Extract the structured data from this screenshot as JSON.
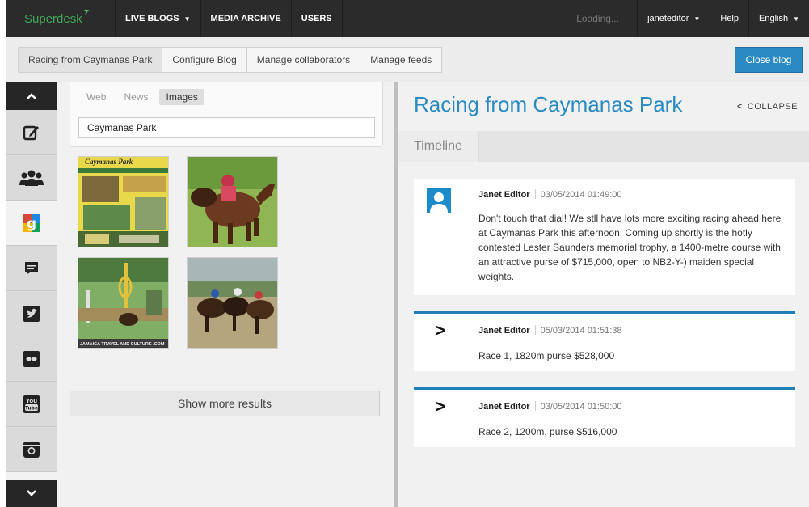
{
  "topbar": {
    "brand": "Superdesk",
    "nav": [
      {
        "label": "LIVE BLOGS",
        "caret": true
      },
      {
        "label": "MEDIA ARCHIVE",
        "caret": false
      },
      {
        "label": "USERS",
        "caret": false
      }
    ],
    "loading": "Loading...",
    "user": "janeteditor",
    "help": "Help",
    "language": "English",
    "brand_color": "#3fa857"
  },
  "tabbar": {
    "tabs": [
      "Racing from Caymanas Park",
      "Configure Blog",
      "Manage collaborators",
      "Manage feeds"
    ],
    "close_label": "Close blog"
  },
  "sidebar": {
    "icons": [
      "edit-icon",
      "users-icon",
      "google-icon",
      "comment-icon",
      "twitter-icon",
      "flickr-icon",
      "youtube-icon",
      "instagram-icon"
    ]
  },
  "search": {
    "tabs": [
      "Web",
      "News",
      "Images"
    ],
    "active_tab": "Images",
    "query": "Caymanas Park",
    "show_more": "Show more results"
  },
  "images": [
    {
      "alt": "Caymanas Park flyer",
      "overlay": "Caymanas Park"
    },
    {
      "alt": "Horse race photo"
    },
    {
      "alt": "Track photo",
      "overlay": "JAMAICA TRAVEL AND CULTURE .COM"
    },
    {
      "alt": "Horses racing photo"
    }
  ],
  "blog": {
    "title": "Racing from Caymanas Park",
    "collapse": "COLLAPSE",
    "timeline": "Timeline",
    "accent": "#2a8ac3",
    "posts": [
      {
        "author": "Janet Editor",
        "date": "03/05/2014 01:49:00",
        "text": "Don't touch that dial! We stll have lots more exciting racing ahead here at Caymanas Park this afternoon. Coming up shortly is the hotly contested Lester Saunders memorial trophy, a 1400-metre course with an attractive purse of $715,000, open to NB2-Y-) maiden special weights."
      },
      {
        "author": "Janet Editor",
        "date": "05/03/2014 01:51:38",
        "text": "Race 1, 1820m purse $528,000"
      },
      {
        "author": "Janet Editor",
        "date": "03/05/2014 01:50:00",
        "text": "Race 2, 1200m, purse $516,000"
      }
    ]
  }
}
